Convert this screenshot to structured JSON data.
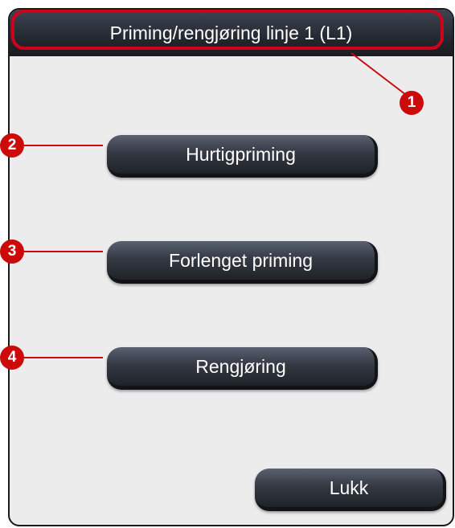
{
  "dialog": {
    "title": "Priming/rengjøring linje 1 (L1)",
    "buttons": {
      "quick_priming": "Hurtigpriming",
      "extended_priming": "Forlenget priming",
      "cleaning": "Rengjøring",
      "close": "Lukk"
    }
  },
  "callouts": [
    "1",
    "2",
    "3",
    "4"
  ],
  "colors": {
    "callout_red": "#cc0a0a",
    "title_bar": "#23272e",
    "button": "#2e333c",
    "dialog_background": "#ececec"
  }
}
